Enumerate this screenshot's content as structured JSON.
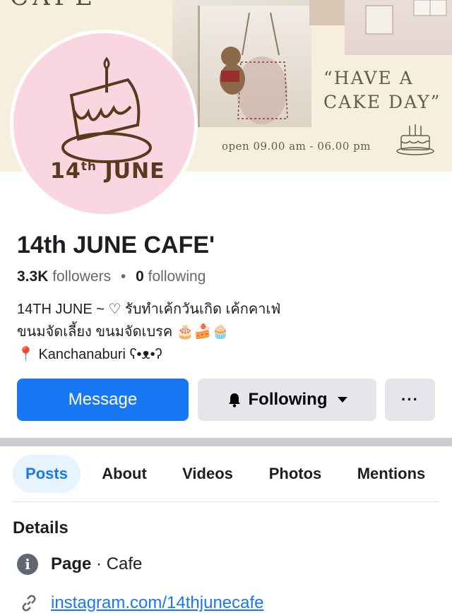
{
  "cover": {
    "title": "CAFE",
    "quote_line1": "“HAVE A",
    "quote_line2": "CAKE DAY”",
    "hours": "open 09.00 am - 06.00 pm",
    "icon": "cake-drawing"
  },
  "avatar": {
    "caption_day": "14",
    "caption_sup": "th",
    "caption_month": "JUNE",
    "icon": "birthday-cake-drawing",
    "background": "#f9d6e0"
  },
  "page": {
    "name": "14th JUNE CAFE'",
    "followers_count": "3.3K",
    "followers_label": "followers",
    "separator": "•",
    "following_count": "0",
    "following_label": "following"
  },
  "bio": {
    "line1": "14TH JUNE ~ ♡ รับทำเค้กวันเกิด เค้กคาเฟ่",
    "line2": "ขนมจัดเลี้ยง ขนมจัดเบรค 🎂🍰🧁",
    "line3": "📍 Kanchanaburi ʕ•ᴥ•ʔ"
  },
  "actions": {
    "message_label": "Message",
    "following_label": "Following",
    "more_label": "···",
    "accent": "#1877f2"
  },
  "tabs": [
    {
      "label": "Posts",
      "active": true
    },
    {
      "label": "About",
      "active": false
    },
    {
      "label": "Videos",
      "active": false
    },
    {
      "label": "Photos",
      "active": false
    },
    {
      "label": "Mentions",
      "active": false
    }
  ],
  "details": {
    "title": "Details",
    "category_bold": "Page",
    "category_rest": " · Cafe",
    "link": "instagram.com/14thjunecafe"
  }
}
